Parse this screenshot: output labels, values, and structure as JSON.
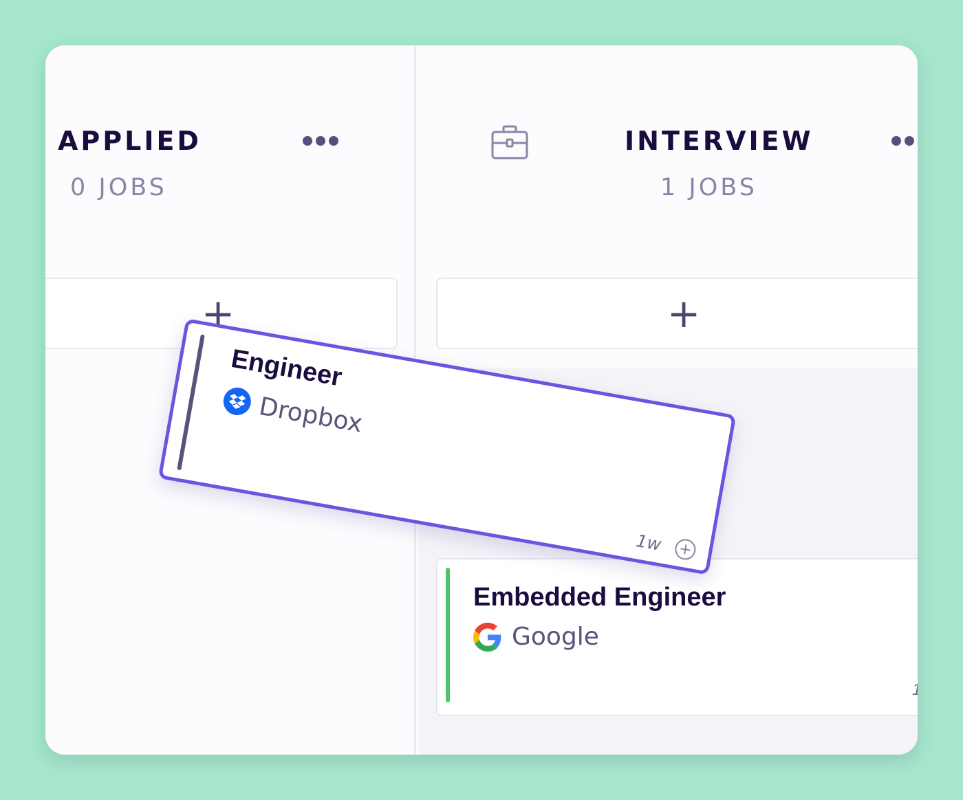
{
  "columns": [
    {
      "title": "APPLIED",
      "count": "0 JOBS",
      "add_label": "+"
    },
    {
      "title": "INTERVIEW",
      "count": "1 JOBS",
      "add_label": "+"
    }
  ],
  "dragging_card": {
    "title": "Engineer",
    "company": "Dropbox",
    "age": "1w",
    "accent_color": "#58537e",
    "border_color": "#6b55e0",
    "logo": "dropbox-icon"
  },
  "interview_card": {
    "title": "Embedded Engineer",
    "company": "Google",
    "accent_color": "#4cc46e",
    "logo": "google-icon"
  },
  "colors": {
    "background": "#a6e6cd",
    "title_text": "#1a0c3e",
    "count_text": "#8c84a6"
  }
}
